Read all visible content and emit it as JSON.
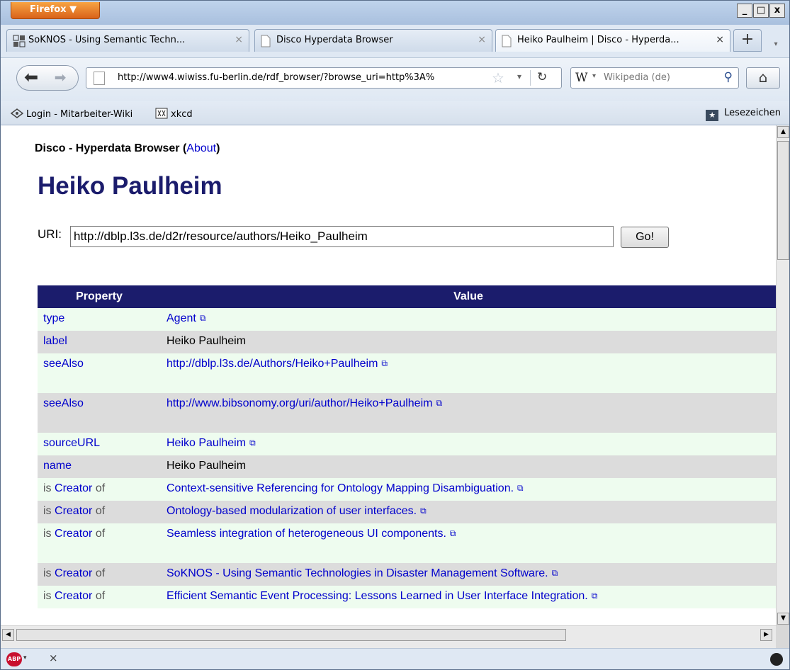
{
  "browser": {
    "menu_button": "Firefox ▼",
    "window_controls": [
      "_",
      "□",
      "x"
    ],
    "tabs": [
      {
        "title": "SoKNOS - Using Semantic Techn...",
        "close": "×"
      },
      {
        "title": "Disco Hyperdata Browser",
        "close": "×"
      },
      {
        "title": "Heiko Paulheim | Disco - Hyperda...",
        "close": "×"
      }
    ],
    "new_tab": "+",
    "url": "http://www4.wiwiss.fu-berlin.de/rdf_browser/?browse_uri=http%3A%",
    "search_engine_glyph": "W",
    "search_placeholder": "Wikipedia (de)",
    "bookmarks": [
      {
        "label": "Login - Mitarbeiter-Wiki"
      },
      {
        "label": "xkcd"
      }
    ],
    "bookmarks_menu": "Lesezeichen"
  },
  "page": {
    "brand": "Disco - Hyperdata Browser",
    "about_link": "About",
    "heading": "Heiko Paulheim",
    "uri_label": "URI:",
    "uri_value": "http://dblp.l3s.de/d2r/resource/authors/Heiko_Paulheim",
    "go_button": "Go!",
    "table": {
      "headers": [
        "Property",
        "Value"
      ],
      "rows": [
        {
          "prefix": "",
          "property": "type",
          "suffix": "",
          "value": "Agent",
          "value_link": true
        },
        {
          "prefix": "",
          "property": "label",
          "suffix": "",
          "value": "Heiko Paulheim",
          "value_link": false
        },
        {
          "prefix": "",
          "property": "seeAlso",
          "suffix": "",
          "value": "http://dblp.l3s.de/Authors/Heiko+Paulheim",
          "value_link": true
        },
        {
          "prefix": "",
          "property": "seeAlso",
          "suffix": "",
          "value": "http://www.bibsonomy.org/uri/author/Heiko+Paulheim",
          "value_link": true
        },
        {
          "prefix": "",
          "property": "sourceURL",
          "suffix": "",
          "value": "Heiko Paulheim",
          "value_link": true
        },
        {
          "prefix": "",
          "property": "name",
          "suffix": "",
          "value": "Heiko Paulheim",
          "value_link": false
        },
        {
          "prefix": "is",
          "property": "Creator",
          "suffix": "of",
          "value": "Context-sensitive Referencing for Ontology Mapping Disambiguation.",
          "value_link": true
        },
        {
          "prefix": "is",
          "property": "Creator",
          "suffix": "of",
          "value": "Ontology-based modularization of user interfaces.",
          "value_link": true
        },
        {
          "prefix": "is",
          "property": "Creator",
          "suffix": "of",
          "value": "Seamless integration of heterogeneous UI components.",
          "value_link": true
        },
        {
          "prefix": "is",
          "property": "Creator",
          "suffix": "of",
          "value": "SoKNOS - Using Semantic Technologies in Disaster Management Software.",
          "value_link": true
        },
        {
          "prefix": "is",
          "property": "Creator",
          "suffix": "of",
          "value": "Efficient Semantic Event Processing: Lessons Learned in User Interface Integration.",
          "value_link": true
        }
      ]
    }
  },
  "statusbar": {
    "addon_badge": "ABP",
    "close": "×"
  },
  "colors": {
    "header_bg": "#1b1c6c",
    "row_odd": "#eefcef",
    "row_even": "#dcdcdc",
    "link": "#0000cc"
  }
}
